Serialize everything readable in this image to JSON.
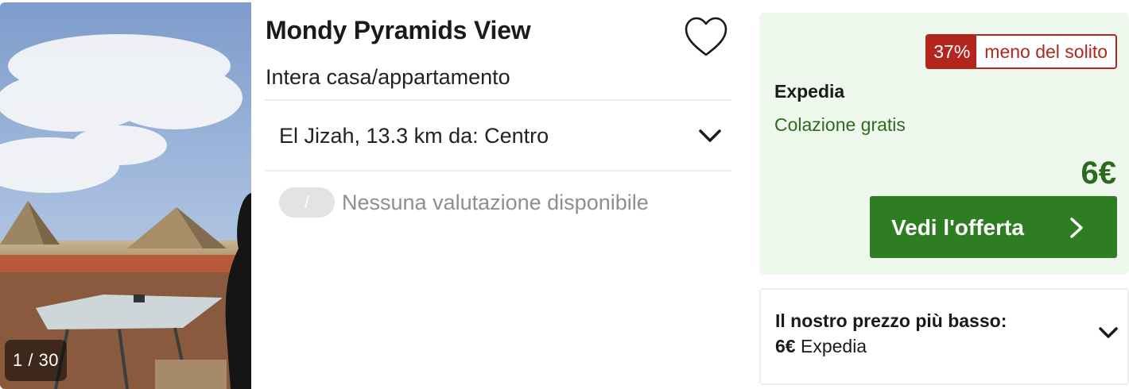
{
  "photo": {
    "counter": "1 / 30",
    "alt": "hotel-photo"
  },
  "listing": {
    "title": "Mondy Pyramids View",
    "type": "Intera casa/appartamento",
    "location": "El Jizah, 13.3 km da: Centro",
    "rating_badge": "/",
    "rating_text": "Nessuna valutazione disponibile",
    "favorite_icon": "heart-outline-icon"
  },
  "deal": {
    "discount_pct": "37%",
    "discount_text": "meno del solito",
    "provider": "Expedia",
    "perk": "Colazione gratis",
    "price": "6€",
    "cta_label": "Vedi l'offerta",
    "accent_color": "#2e7d22",
    "badge_color": "#b3261e",
    "panel_bg": "#eff8ec"
  },
  "lowest": {
    "title": "Il nostro prezzo più basso:",
    "price": "6€",
    "provider": "Expedia"
  }
}
